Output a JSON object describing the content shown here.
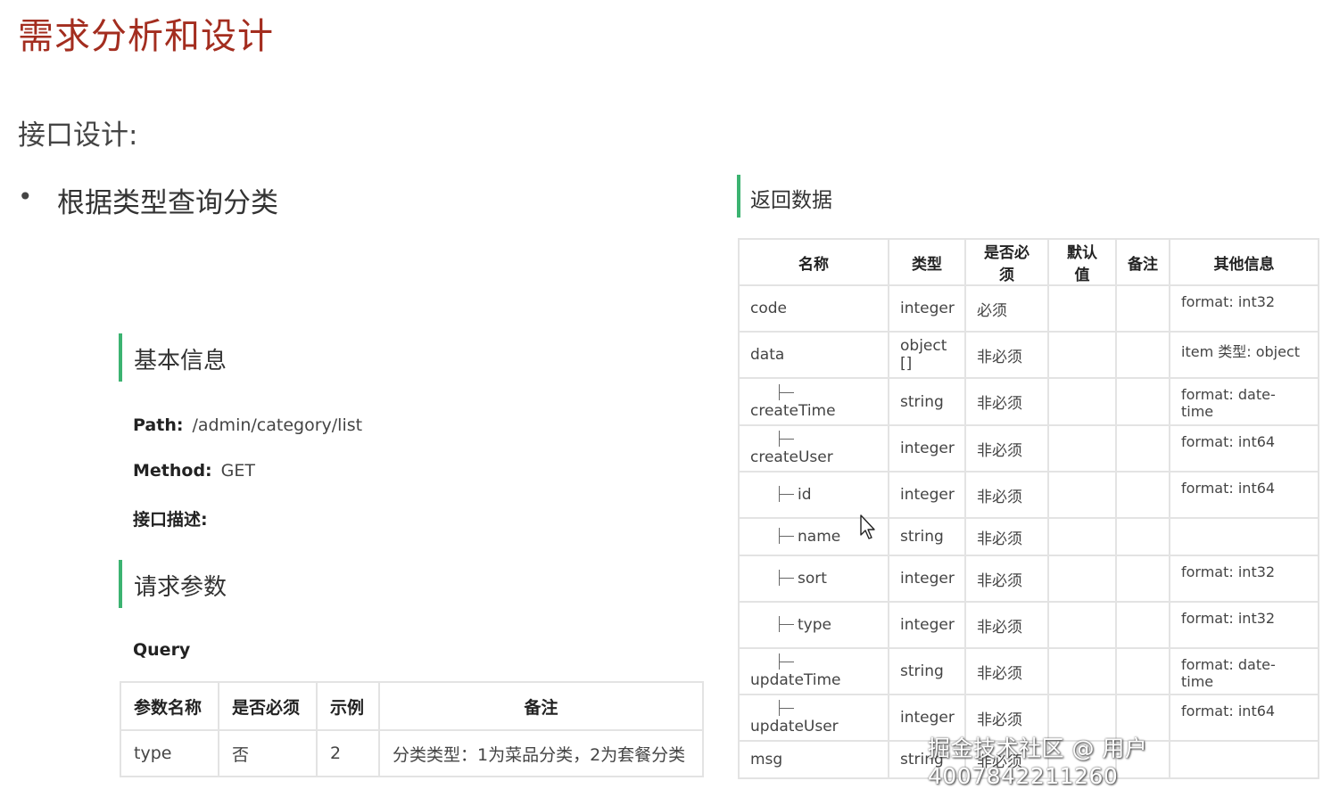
{
  "main_title": "需求分析和设计",
  "sub_title": "接口设计:",
  "bullet": "根据类型查询分类",
  "basic_info": {
    "title": "基本信息",
    "path_label": "Path:",
    "path_value": "/admin/category/list",
    "method_label": "Method:",
    "method_value": "GET",
    "desc_label": "接口描述:"
  },
  "request": {
    "title": "请求参数",
    "query_label": "Query",
    "headers": [
      "参数名称",
      "是否必须",
      "示例",
      "备注"
    ],
    "rows": [
      [
        "type",
        "否",
        "2",
        "分类类型：1为菜品分类，2为套餐分类"
      ]
    ]
  },
  "response": {
    "title": "返回数据",
    "headers": [
      "名称",
      "类型",
      "是否必须",
      "默认值",
      "备注",
      "其他信息"
    ],
    "rows": [
      {
        "name": "code",
        "type": "integer",
        "required": "必须",
        "default": "",
        "note": "",
        "info": "format: int32",
        "child": false
      },
      {
        "name": "data",
        "type": "object []",
        "required": "非必须",
        "default": "",
        "note": "",
        "info": "item 类型: object",
        "child": false
      },
      {
        "name": "createTime",
        "type": "string",
        "required": "非必须",
        "default": "",
        "note": "",
        "info": "format: date-time",
        "child": true
      },
      {
        "name": "createUser",
        "type": "integer",
        "required": "非必须",
        "default": "",
        "note": "",
        "info": "format: int64",
        "child": true
      },
      {
        "name": "id",
        "type": "integer",
        "required": "非必须",
        "default": "",
        "note": "",
        "info": "format: int64",
        "child": true
      },
      {
        "name": "name",
        "type": "string",
        "required": "非必须",
        "default": "",
        "note": "",
        "info": "",
        "child": true
      },
      {
        "name": "sort",
        "type": "integer",
        "required": "非必须",
        "default": "",
        "note": "",
        "info": "format: int32",
        "child": true
      },
      {
        "name": "type",
        "type": "integer",
        "required": "非必须",
        "default": "",
        "note": "",
        "info": "format: int32",
        "child": true
      },
      {
        "name": "updateTime",
        "type": "string",
        "required": "非必须",
        "default": "",
        "note": "",
        "info": "format: date-time",
        "child": true
      },
      {
        "name": "updateUser",
        "type": "integer",
        "required": "非必须",
        "default": "",
        "note": "",
        "info": "format: int64",
        "child": true
      },
      {
        "name": "msg",
        "type": "string",
        "required": "非必须",
        "default": "",
        "note": "",
        "info": "",
        "child": false
      }
    ]
  },
  "watermark": "掘金技术社区 @ 用户4007842211260",
  "colors": {
    "title": "#a32d1f",
    "accent_bar": "#3cb371",
    "table_border": "#e3e3e3"
  }
}
